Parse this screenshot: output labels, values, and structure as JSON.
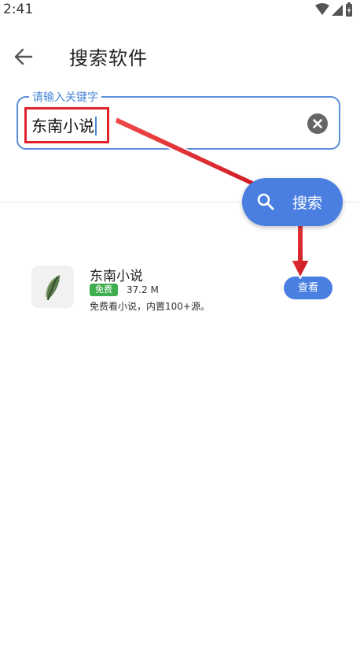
{
  "status_bar": {
    "time": "2:41",
    "icons": [
      "wifi-icon",
      "signal-icon",
      "battery-charging-icon"
    ]
  },
  "header": {
    "back_icon": "arrow-left-icon",
    "title": "搜索软件"
  },
  "search": {
    "label": "请输入关键字",
    "value": "东南小说",
    "clear_icon": "clear-circle-icon",
    "button_label": "搜索",
    "button_icon": "search-icon"
  },
  "results": [
    {
      "name": "东南小说",
      "badge": "免费",
      "size": "37.2 M",
      "description": "免费看小说，内置100+源。",
      "action": "查看",
      "icon": "feather-leaf-icon"
    }
  ],
  "colors": {
    "accent": "#4a7fe1",
    "field_border": "#5b8fd8",
    "badge_green": "#3fae4f",
    "annotation_red": "#e0232b"
  }
}
